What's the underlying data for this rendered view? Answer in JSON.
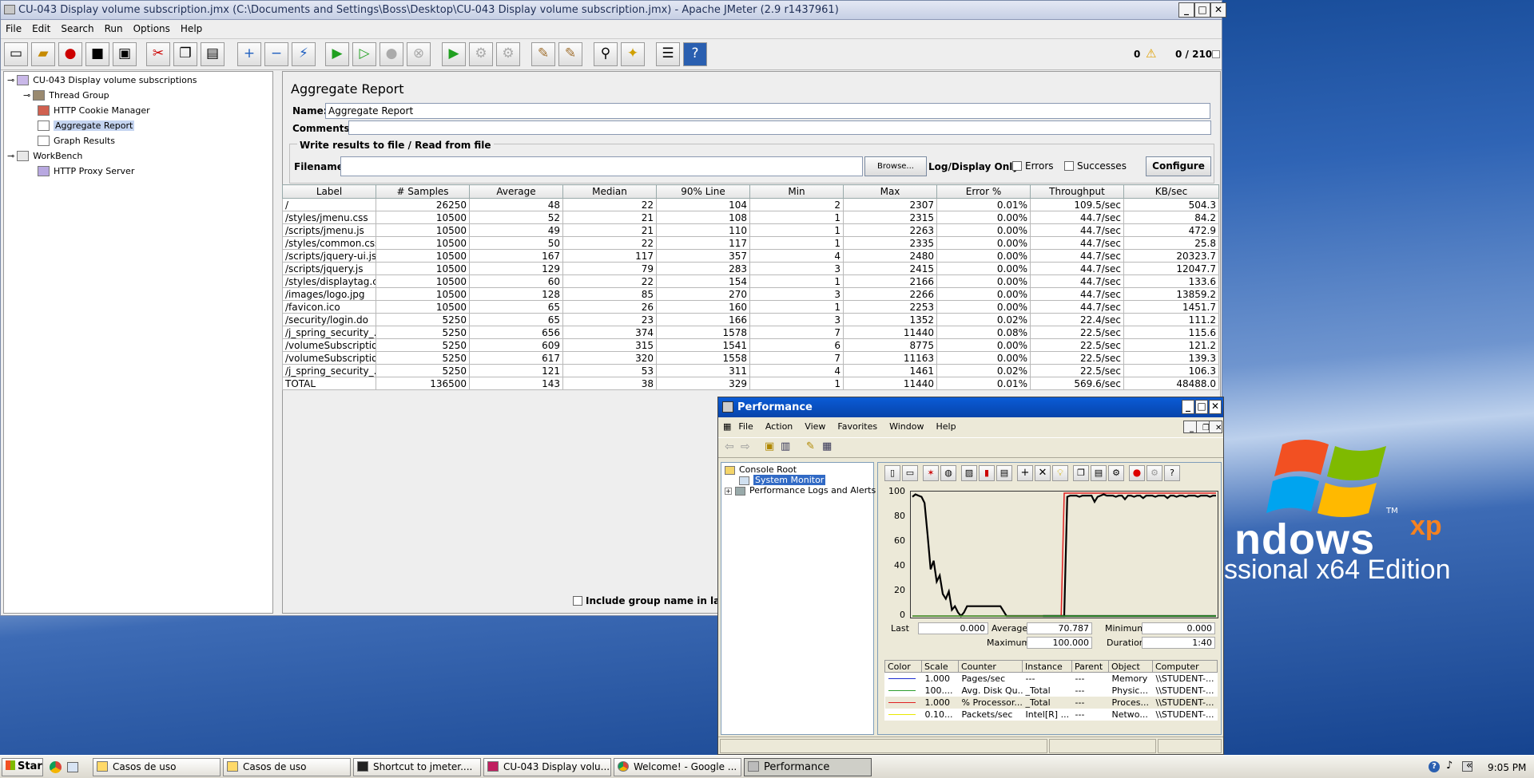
{
  "jmeter": {
    "title": "CU-043 Display volume subscription.jmx (C:\\Documents and Settings\\Boss\\Desktop\\CU-043 Display volume subscription.jmx) - Apache JMeter (2.9 r1437961)",
    "menu": [
      "File",
      "Edit",
      "Search",
      "Run",
      "Options",
      "Help"
    ],
    "error_count": "0",
    "threads": "0 / 210",
    "tree": [
      {
        "label": "CU-043 Display volume subscriptions"
      },
      {
        "label": "Thread Group"
      },
      {
        "label": "HTTP Cookie Manager"
      },
      {
        "label": "Aggregate Report"
      },
      {
        "label": "Graph Results"
      },
      {
        "label": "WorkBench"
      },
      {
        "label": "HTTP Proxy Server"
      }
    ],
    "panel": {
      "title": "Aggregate Report",
      "name_label": "Name:",
      "name_value": "Aggregate Report",
      "comments_label": "Comments:",
      "write_section": "Write results to file / Read from file",
      "filename_label": "Filename",
      "browse": "Browse...",
      "log_display": "Log/Display Only:",
      "errors": "Errors",
      "successes": "Successes",
      "configure": "Configure",
      "include_group": "Include group name in label?"
    },
    "table": {
      "columns": [
        "Label",
        "# Samples",
        "Average",
        "Median",
        "90% Line",
        "Min",
        "Max",
        "Error %",
        "Throughput",
        "KB/sec"
      ],
      "rows": [
        [
          "/",
          "26250",
          "48",
          "22",
          "104",
          "2",
          "2307",
          "0.01%",
          "109.5/sec",
          "504.3"
        ],
        [
          "/styles/jmenu.css",
          "10500",
          "52",
          "21",
          "108",
          "1",
          "2315",
          "0.00%",
          "44.7/sec",
          "84.2"
        ],
        [
          "/scripts/jmenu.js",
          "10500",
          "49",
          "21",
          "110",
          "1",
          "2263",
          "0.00%",
          "44.7/sec",
          "472.9"
        ],
        [
          "/styles/common.css",
          "10500",
          "50",
          "22",
          "117",
          "1",
          "2335",
          "0.00%",
          "44.7/sec",
          "25.8"
        ],
        [
          "/scripts/jquery-ui.js",
          "10500",
          "167",
          "117",
          "357",
          "4",
          "2480",
          "0.00%",
          "44.7/sec",
          "20323.7"
        ],
        [
          "/scripts/jquery.js",
          "10500",
          "129",
          "79",
          "283",
          "3",
          "2415",
          "0.00%",
          "44.7/sec",
          "12047.7"
        ],
        [
          "/styles/displaytag.c...",
          "10500",
          "60",
          "22",
          "154",
          "1",
          "2166",
          "0.00%",
          "44.7/sec",
          "133.6"
        ],
        [
          "/images/logo.jpg",
          "10500",
          "128",
          "85",
          "270",
          "3",
          "2266",
          "0.00%",
          "44.7/sec",
          "13859.2"
        ],
        [
          "/favicon.ico",
          "10500",
          "65",
          "26",
          "160",
          "1",
          "2253",
          "0.00%",
          "44.7/sec",
          "1451.7"
        ],
        [
          "/security/login.do",
          "5250",
          "65",
          "23",
          "166",
          "3",
          "1352",
          "0.02%",
          "22.4/sec",
          "111.2"
        ],
        [
          "/j_spring_security_...",
          "5250",
          "656",
          "374",
          "1578",
          "7",
          "11440",
          "0.08%",
          "22.5/sec",
          "115.6"
        ],
        [
          "/volumeSubscriptio...",
          "5250",
          "609",
          "315",
          "1541",
          "6",
          "8775",
          "0.00%",
          "22.5/sec",
          "121.2"
        ],
        [
          "/volumeSubscriptio...",
          "5250",
          "617",
          "320",
          "1558",
          "7",
          "11163",
          "0.00%",
          "22.5/sec",
          "139.3"
        ],
        [
          "/j_spring_security_...",
          "5250",
          "121",
          "53",
          "311",
          "4",
          "1461",
          "0.02%",
          "22.5/sec",
          "106.3"
        ],
        [
          "TOTAL",
          "136500",
          "143",
          "38",
          "329",
          "1",
          "11440",
          "0.01%",
          "569.6/sec",
          "48488.0"
        ]
      ]
    }
  },
  "performance": {
    "title": "Performance",
    "menu": [
      "File",
      "Action",
      "View",
      "Favorites",
      "Window",
      "Help"
    ],
    "tree": {
      "root": "Console Root",
      "monitor": "System Monitor",
      "logs": "Performance Logs and Alerts"
    },
    "stats": {
      "last_label": "Last",
      "last": "0.000",
      "average_label": "Average",
      "average": "70.787",
      "minimum_label": "Minimum",
      "minimum": "0.000",
      "maximum_label": "Maximum",
      "maximum": "100.000",
      "duration_label": "Duration",
      "duration": "1:40"
    },
    "counter_columns": [
      "Color",
      "Scale",
      "Counter",
      "Instance",
      "Parent",
      "Object",
      "Computer"
    ],
    "counters": [
      {
        "color": "#1f2fd0",
        "scale": "1.000",
        "counter": "Pages/sec",
        "instance": "---",
        "parent": "---",
        "object": "Memory",
        "computer": "\\\\STUDENT-..."
      },
      {
        "color": "#2e9e2e",
        "scale": "100....",
        "counter": "Avg. Disk Qu...",
        "instance": "_Total",
        "parent": "---",
        "object": "Physic...",
        "computer": "\\\\STUDENT-..."
      },
      {
        "color": "#e02020",
        "scale": "1.000",
        "counter": "% Processor...",
        "instance": "_Total",
        "parent": "---",
        "object": "Proces...",
        "computer": "\\\\STUDENT-..."
      },
      {
        "color": "#e8e800",
        "scale": "0.10...",
        "counter": "Packets/sec",
        "instance": "Intel[R] ...",
        "parent": "---",
        "object": "Netwo...",
        "computer": "\\\\STUDENT-..."
      }
    ]
  },
  "chart_data": {
    "type": "line",
    "ylim": [
      0,
      100
    ],
    "yticks": [
      "100",
      "80",
      "60",
      "40",
      "20",
      "0"
    ],
    "series": [
      {
        "color": "#000000",
        "x": [
          0,
          1,
          2,
          3,
          4,
          5,
          6,
          7,
          8,
          9,
          10,
          11,
          12,
          13,
          14,
          15,
          16,
          17,
          18,
          19,
          20,
          21,
          22,
          23,
          24,
          25,
          26,
          27,
          28,
          29,
          30,
          31,
          32,
          33,
          34,
          35,
          36,
          37,
          38,
          39,
          40,
          41,
          42,
          43,
          44,
          45,
          46,
          47,
          48,
          49,
          50,
          51,
          52,
          53,
          54,
          55,
          56,
          57,
          58,
          59,
          60,
          61,
          62,
          63,
          64,
          65,
          66,
          67,
          68,
          69,
          70,
          71,
          72,
          73,
          74,
          75,
          76,
          77,
          78,
          79,
          80,
          81,
          82,
          83,
          84,
          85,
          86,
          87,
          88,
          89,
          90,
          91,
          92,
          93,
          94,
          95,
          96,
          97,
          98,
          99,
          100
        ],
        "y": [
          97,
          99,
          98,
          97,
          92,
          66,
          38,
          45,
          28,
          33,
          18,
          14,
          20,
          5,
          8,
          3,
          0,
          3,
          8,
          8,
          8,
          8,
          8,
          8,
          8,
          8,
          8,
          8,
          8,
          8,
          4,
          0,
          0,
          0,
          0,
          0,
          0,
          0,
          0,
          0,
          0,
          0,
          0,
          0,
          0,
          0,
          0,
          0,
          0,
          0,
          0,
          0,
          0,
          0,
          0,
          0,
          0,
          0,
          0,
          0,
          0,
          0,
          0,
          0,
          0,
          0,
          0,
          0,
          0,
          0,
          0,
          0,
          0,
          0,
          0,
          0,
          0,
          0,
          0,
          0,
          0,
          0,
          0,
          0,
          0,
          0,
          0,
          0,
          0,
          0,
          0,
          0,
          0,
          0,
          0,
          0,
          0,
          0,
          0,
          0,
          0
        ]
      },
      {
        "color": "#e02020",
        "x": [
          0,
          1,
          2,
          3,
          4,
          5,
          6,
          7,
          8,
          9,
          10,
          11,
          12,
          13,
          14,
          15,
          16,
          17,
          18,
          19,
          20,
          21,
          22,
          23,
          24,
          25,
          26,
          27,
          28,
          29,
          30,
          31,
          32,
          33,
          34,
          35,
          36,
          37,
          38,
          39,
          40,
          41,
          42,
          43,
          44,
          45,
          46,
          47,
          48,
          49,
          50,
          51,
          52,
          53,
          54,
          55,
          56,
          57,
          58,
          59,
          60,
          61,
          62,
          63,
          64,
          65,
          66,
          67,
          68,
          69,
          70,
          71,
          72,
          73,
          74,
          75,
          76,
          77,
          78,
          79,
          80,
          81,
          82,
          83,
          84,
          85,
          86,
          87,
          88,
          89,
          90,
          91,
          92,
          93,
          94,
          95,
          96,
          97,
          98,
          99,
          100
        ],
        "y": [
          0,
          0,
          0,
          0,
          0,
          0,
          0,
          0,
          0,
          0,
          0,
          0,
          0,
          0,
          0,
          0,
          0,
          0,
          0,
          0,
          0,
          0,
          0,
          0,
          0,
          0,
          0,
          0,
          0,
          0,
          0,
          0,
          0,
          0,
          0,
          0,
          0,
          0,
          0,
          0,
          0,
          0,
          0,
          0,
          0,
          0,
          0,
          0,
          0,
          0,
          100,
          100,
          100,
          100,
          100,
          100,
          100,
          100,
          100,
          100,
          100,
          100,
          100,
          100,
          100,
          100,
          100,
          100,
          100,
          100,
          100,
          100,
          100,
          100,
          100,
          100,
          100,
          100,
          100,
          100,
          100,
          100,
          100,
          100,
          100,
          100,
          100,
          100,
          100,
          100,
          100,
          100,
          100,
          100,
          100,
          100,
          100,
          100,
          100,
          100,
          100
        ]
      },
      {
        "color": "#000000",
        "x": [
          43,
          44,
          45,
          46,
          47,
          48,
          49,
          50,
          51,
          52,
          53,
          54,
          55,
          56,
          57,
          58,
          59,
          60,
          61,
          62,
          63,
          64,
          65,
          66,
          67,
          68,
          69,
          70,
          71,
          72,
          73,
          74,
          75,
          76,
          77,
          78,
          79,
          80,
          81,
          82,
          83,
          84,
          85,
          86,
          87,
          88,
          89,
          90,
          91,
          92,
          93,
          94,
          95,
          96,
          97,
          98,
          99,
          100
        ],
        "y": [
          0,
          0,
          0,
          0,
          0,
          0,
          0,
          0,
          97,
          98,
          98,
          98,
          97,
          98,
          98,
          98,
          98,
          93,
          97,
          98,
          99,
          98,
          98,
          98,
          97,
          98,
          98,
          95,
          98,
          98,
          97,
          98,
          98,
          96,
          98,
          98,
          98,
          97,
          98,
          98,
          98,
          96,
          98,
          98,
          97,
          98,
          98,
          97,
          98,
          98,
          98,
          97,
          98,
          98,
          98,
          97,
          98,
          98
        ]
      },
      {
        "color": "#2e9e2e",
        "x": [
          0,
          100
        ],
        "y": [
          0,
          0
        ]
      }
    ]
  },
  "desktop": {
    "brand": "ndows",
    "sup": "xp",
    "tm": "TM",
    "edition": "ssional x64 Edition"
  },
  "taskbar": {
    "start": "Start",
    "items": [
      "Casos de uso",
      "Casos de uso",
      "Shortcut to jmeter....",
      "CU-043 Display volu...",
      "Welcome! - Google ...",
      "Performance"
    ],
    "time": "9:05 PM"
  }
}
